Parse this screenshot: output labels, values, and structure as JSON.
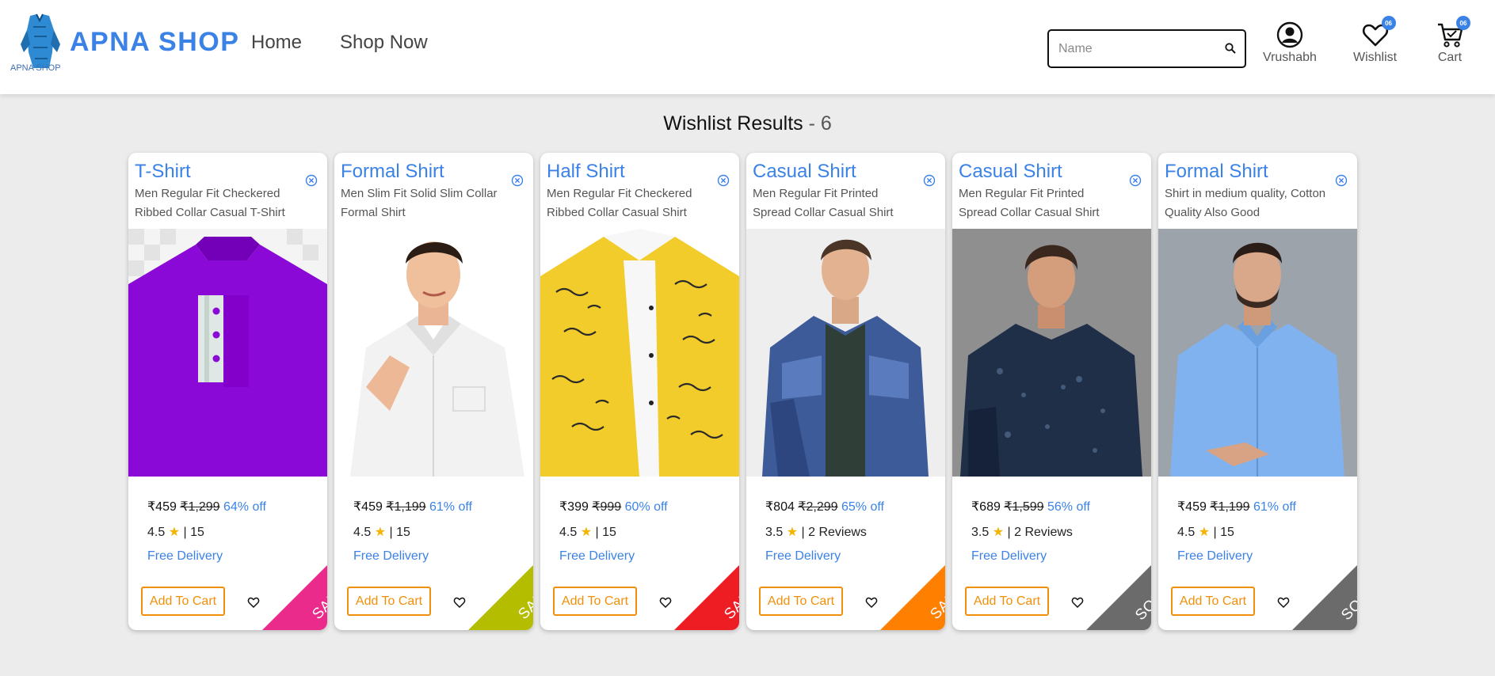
{
  "header": {
    "logo_caption": "APNA SHOP",
    "brand": "APNA SHOP",
    "nav": {
      "home": "Home",
      "shop_now": "Shop Now"
    },
    "search": {
      "placeholder": "Name",
      "value": ""
    },
    "user_label": "Vrushabh",
    "wishlist_label": "Wishlist",
    "wishlist_count": "06",
    "cart_label": "Cart",
    "cart_count": "06"
  },
  "results": {
    "label": "Wishlist Results",
    "count": "- 6"
  },
  "colors": {
    "accent": "#3b82e6",
    "button_orange": "#f0900a",
    "star": "#f5b400",
    "ribbon_pink": "#ea2b8c",
    "ribbon_olive": "#b5bd00",
    "ribbon_red": "#ee1d24",
    "ribbon_orange": "#ff7f00",
    "ribbon_gray": "#6b6b6b"
  },
  "products": [
    {
      "title": "T-Shirt",
      "desc": "Men Regular Fit Checkered Ribbed Collar Casual T-Shirt",
      "price": "₹459",
      "mrp": "₹1,299",
      "off": "64% off",
      "rating": "4.5",
      "reviews": "15",
      "delivery": "Free Delivery",
      "cart_label": "Add To Cart",
      "ribbon": "SALE",
      "ribbon_color": "#ea2b8c"
    },
    {
      "title": "Formal Shirt",
      "desc": "Men Slim Fit Solid Slim Collar Formal Shirt",
      "price": "₹459",
      "mrp": "₹1,199",
      "off": "61% off",
      "rating": "4.5",
      "reviews": "15",
      "delivery": "Free Delivery",
      "cart_label": "Add To Cart",
      "ribbon": "SALE",
      "ribbon_color": "#b5bd00"
    },
    {
      "title": "Half Shirt",
      "desc": "Men Regular Fit Checkered Ribbed Collar Casual Shirt",
      "price": "₹399",
      "mrp": "₹999",
      "off": "60% off",
      "rating": "4.5",
      "reviews": "15",
      "delivery": "Free Delivery",
      "cart_label": "Add To Cart",
      "ribbon": "SALE",
      "ribbon_color": "#ee1d24"
    },
    {
      "title": "Casual Shirt",
      "desc": "Men Regular Fit Printed Spread Collar Casual Shirt",
      "price": "₹804",
      "mrp": "₹2,299",
      "off": "65% off",
      "rating": "3.5",
      "reviews": "2 Reviews",
      "delivery": "Free Delivery",
      "cart_label": "Add To Cart",
      "ribbon": "SALE",
      "ribbon_color": "#ff7f00"
    },
    {
      "title": "Casual Shirt",
      "desc": "Men Regular Fit Printed Spread Collar Casual Shirt",
      "price": "₹689",
      "mrp": "₹1,599",
      "off": "56% off",
      "rating": "3.5",
      "reviews": "2 Reviews",
      "delivery": "Free Delivery",
      "cart_label": "Add To Cart",
      "ribbon": "SOLD",
      "ribbon_color": "#6b6b6b"
    },
    {
      "title": "Formal Shirt",
      "desc": "Shirt in medium quality, Cotton Quality Also Good",
      "price": "₹459",
      "mrp": "₹1,199",
      "off": "61% off",
      "rating": "4.5",
      "reviews": "15",
      "delivery": "Free Delivery",
      "cart_label": "Add To Cart",
      "ribbon": "SOLD",
      "ribbon_color": "#6b6b6b"
    }
  ]
}
